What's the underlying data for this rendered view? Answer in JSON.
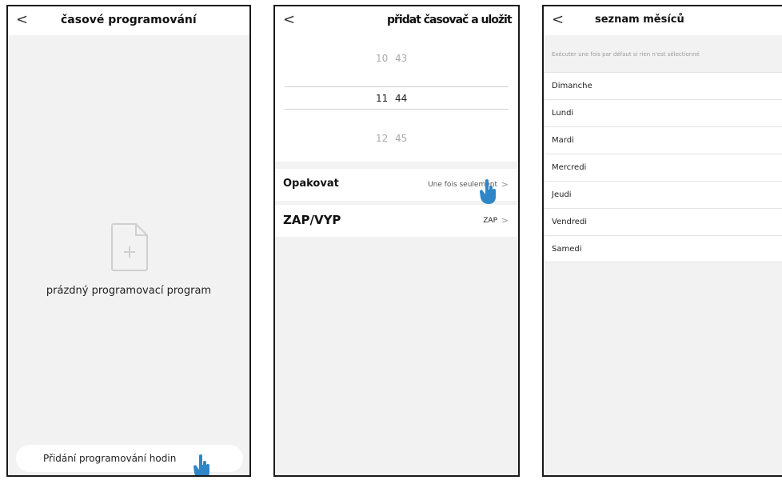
{
  "screen1": {
    "back_glyph": "<",
    "title": "časové programování",
    "empty_icon": "document-plus-icon",
    "empty_text": "prázdný programovací program",
    "add_button_label": "Přidání programování hodin"
  },
  "screen2": {
    "back_glyph": "<",
    "title": "přidat časovač a uložit",
    "picker_rows": [
      {
        "hour": "10",
        "minute": "43"
      },
      {
        "hour": "11",
        "minute": "44"
      },
      {
        "hour": "12",
        "minute": "45"
      }
    ],
    "repeat_label": "Opakovat",
    "repeat_value": "Une fois seulement",
    "onoff_label": "ZAP/VYP",
    "onoff_value": "ZAP",
    "chevron": ">"
  },
  "screen3": {
    "back_glyph": "<",
    "title": "seznam měsíců",
    "hint": "Exécuter une fois par défaut si rien n'est sélectionné",
    "days": [
      "Dimanche",
      "Lundi",
      "Mardi",
      "Mercredi",
      "Jeudi",
      "Vendredi",
      "Samedi"
    ]
  },
  "colors": {
    "background": "#f2f2f2",
    "card": "#ffffff",
    "hand_pointer": "#2f86c6"
  },
  "icons": [
    "back-chevron-icon",
    "document-plus-icon",
    "hand-pointer-icon",
    "chevron-right-icon"
  ]
}
